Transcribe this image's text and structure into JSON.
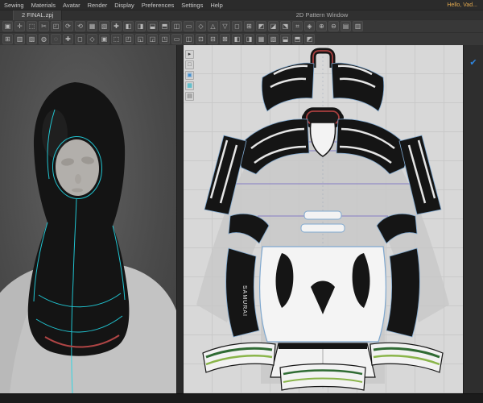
{
  "menubar": {
    "items": [
      "Sewing",
      "Materials",
      "Avatar",
      "Render",
      "Display",
      "Preferences",
      "Settings",
      "Help"
    ],
    "greeting": "Hello, Vad..."
  },
  "tabbar": {
    "tab_label": "2 FINAL.zpj",
    "window_title": "2D Pattern Window"
  },
  "toolbars": {
    "row1": [
      "▣",
      "✛",
      "⬚",
      "✂",
      "◰",
      "⟳",
      "⟲",
      "▦",
      "▧",
      "✚",
      "◧",
      "◨",
      "⬓",
      "⬒",
      "◫",
      "▭",
      "◇",
      "△",
      "▽",
      "◻",
      "⊞",
      "◩",
      "◪",
      "⬔",
      "⌗",
      "◈",
      "⊕",
      "⊖",
      "▤",
      "▥"
    ],
    "row2": [
      "⊞",
      "▥",
      "▨",
      "◍",
      "◌",
      "✚",
      "◻",
      "◇",
      "▣",
      "⬚",
      "◰",
      "◱",
      "◲",
      "◳",
      "▭",
      "◫",
      "⊡",
      "⊟",
      "⊠",
      "◧",
      "◨",
      "▦",
      "▧",
      "⬓",
      "⬒",
      "◩"
    ],
    "mini_2d": [
      {
        "glyph": "▸",
        "color": "#333333"
      },
      {
        "glyph": "□",
        "color": "#555555"
      },
      {
        "glyph": "▣",
        "color": "#3f8fd1"
      },
      {
        "glyph": "▦",
        "color": "#27b7c9"
      },
      {
        "glyph": "▤",
        "color": "#666666"
      }
    ],
    "confirm_check": {
      "glyph": "✔",
      "color": "#2f86e0"
    }
  },
  "pattern": {
    "brand_label": "SAMURAI"
  },
  "colors": {
    "seam_cyan": "#22d7e5",
    "trim_red": "#b04545",
    "stripe_green_dark": "#2f6b33",
    "stripe_green_light": "#8ab54a",
    "seam_purple": "#7b6fc4",
    "outline_blue": "#7fa8cf",
    "canvas_gray": "#d8d8d8"
  }
}
